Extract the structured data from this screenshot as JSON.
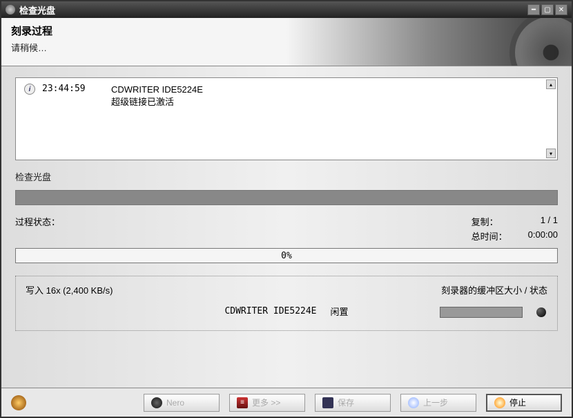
{
  "titlebar": {
    "title": "检查光盘"
  },
  "header": {
    "title": "刻录过程",
    "subtitle": "请稍候…"
  },
  "log": {
    "time": "23:44:59",
    "line1": "CDWRITER IDE5224E",
    "line2": "超级链接已激活"
  },
  "section": {
    "label": "检查光盘"
  },
  "stats": {
    "process_label": "过程状态：",
    "copy_label": "复制：",
    "copy_value": "1 / 1",
    "time_label": "总时间：",
    "time_value": "0:00:00",
    "percent": "0%"
  },
  "bottom": {
    "write_speed": "写入 16x (2,400 KB/s)",
    "buffer_label": "刻录器的缓冲区大小 / 状态",
    "device": "CDWRITER IDE5224E",
    "status": "闲置"
  },
  "footer": {
    "nero": "Nero",
    "more": "更多 >>",
    "save": "保存",
    "back": "上一步",
    "stop": "停止"
  }
}
